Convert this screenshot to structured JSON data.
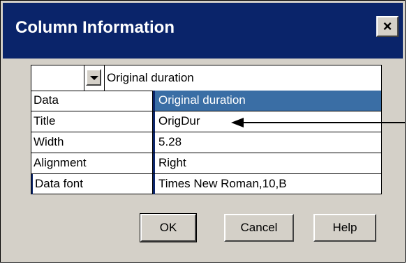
{
  "dialog": {
    "title": "Column Information",
    "close_label": "×"
  },
  "grid": {
    "combo_value": "Original duration",
    "rows": [
      {
        "label": "Data",
        "value": "Original duration"
      },
      {
        "label": "Title",
        "value": "OrigDur"
      },
      {
        "label": "Width",
        "value": "5.28"
      },
      {
        "label": "Alignment",
        "value": "Right"
      },
      {
        "label": "Data font",
        "value": "Times New Roman,10,B"
      }
    ]
  },
  "buttons": {
    "ok": "OK",
    "cancel": "Cancel",
    "help": "Help"
  },
  "colors": {
    "titlebar": "#0a246a",
    "selection": "#3a6ea5",
    "face": "#d4d0c8"
  }
}
